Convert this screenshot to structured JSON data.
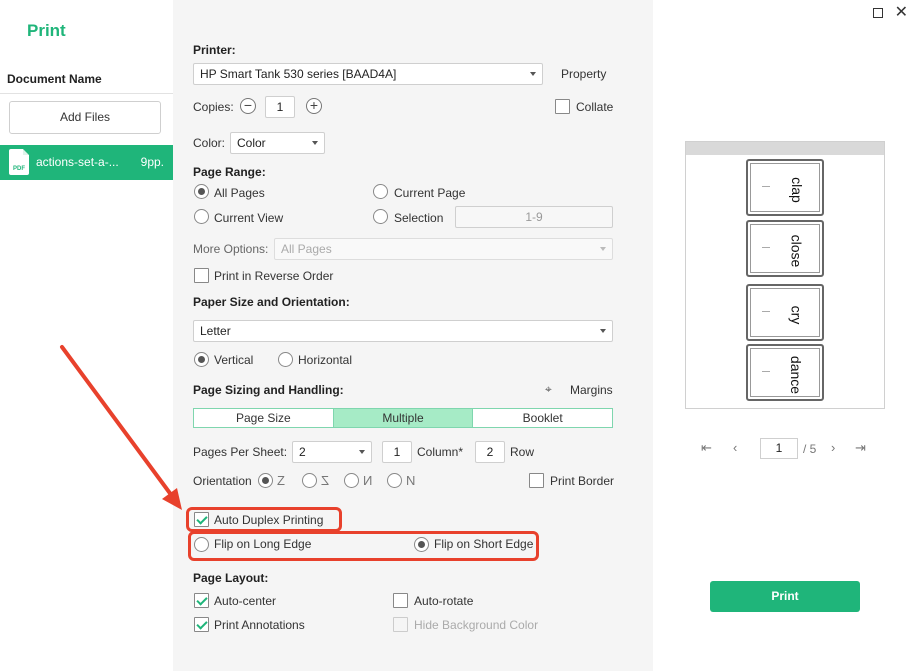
{
  "app": {
    "title": "Print"
  },
  "left": {
    "doc_header": "Document Name",
    "add_files": "Add Files",
    "file": {
      "icon_text": "PDF",
      "name": "actions-set-a-...",
      "pages": "9pp."
    }
  },
  "printer": {
    "label": "Printer:",
    "value": "HP Smart Tank 530 series [BAAD4A]",
    "property": "Property"
  },
  "copies": {
    "label": "Copies:",
    "minus": "−",
    "value": "1",
    "plus": "+",
    "collate": "Collate"
  },
  "color": {
    "label": "Color:",
    "value": "Color"
  },
  "page_range": {
    "label": "Page Range:",
    "all_pages": "All Pages",
    "current_page": "Current Page",
    "current_view": "Current View",
    "selection": "Selection",
    "selection_value": "1-9"
  },
  "more_options": {
    "label": "More Options:",
    "value": "All Pages"
  },
  "reverse_order": "Print in Reverse Order",
  "paper": {
    "label": "Paper Size and Orientation:",
    "size": "Letter",
    "vertical": "Vertical",
    "horizontal": "Horizontal"
  },
  "sizing": {
    "label": "Page Sizing and Handling:",
    "margins": "Margins",
    "tabs": [
      "Page Size",
      "Multiple",
      "Booklet"
    ],
    "active_tab": "Multiple"
  },
  "multiple": {
    "pages_per_sheet_label": "Pages Per Sheet:",
    "pages_per_sheet": "2",
    "columns": "1",
    "column_label": "Column*",
    "rows": "2",
    "row_label": "Row",
    "orientation_label": "Orientation",
    "orientation_icons": [
      "Z",
      "Z",
      "N",
      "N"
    ],
    "print_border": "Print Border"
  },
  "duplex": {
    "auto_duplex": "Auto Duplex Printing",
    "long_edge": "Flip on Long Edge",
    "short_edge": "Flip on Short Edge"
  },
  "layout": {
    "label": "Page Layout:",
    "auto_center": "Auto-center",
    "auto_rotate": "Auto-rotate",
    "print_annotations": "Print Annotations",
    "hide_background": "Hide Background Color"
  },
  "preview": {
    "cards": [
      {
        "word": "clap",
        "sub": "(clap)"
      },
      {
        "word": "close",
        "sub": "(close)"
      },
      {
        "word": "cry",
        "sub": "(cry)"
      },
      {
        "word": "dance",
        "sub": "(dance)"
      }
    ],
    "page_current": "1",
    "page_total": "/ 5"
  },
  "print_button": "Print",
  "colors": {
    "accent": "#1fb57a",
    "annotation": "#e8412c",
    "tab_active": "#a6ebc6"
  }
}
